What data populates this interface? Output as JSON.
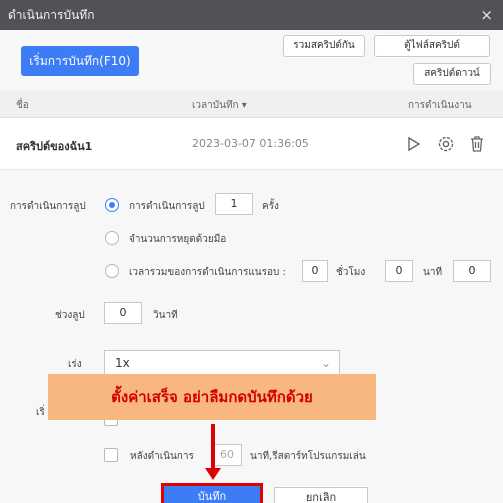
{
  "window": {
    "title": "ดำเนินการบันทึก",
    "close_glyph": "×"
  },
  "toolbar": {
    "record_button": "เริ่มการบันทึก(F10)",
    "merge_script": "รวมสคริปต์กัน",
    "script_folder": "ตู้ไฟล์สคริปต์",
    "download_script": "สคริปต์ดาวน์"
  },
  "table": {
    "headers": {
      "name": "ชื่อ",
      "time": "เวลาบันทึก ▾",
      "actions": "การดำเนินงาน"
    },
    "rows": [
      {
        "name": "สคริปต์ของฉัน1",
        "time": "2023-03-07 01:36:05"
      }
    ]
  },
  "settings": {
    "loop_label": "การดำเนินการลูป",
    "opt_loop": "การดำเนินการลูป",
    "loop_count": "1",
    "loop_unit": "ครั้ง",
    "opt_manual": "จำนวนการหยุดด้วยมือ",
    "opt_time": "เวลารวมของการดำเนินการแนรอบ :",
    "hours": "0",
    "hours_unit": "ชั่วโมง",
    "minutes": "0",
    "minutes_unit": "นาที",
    "seconds": "0",
    "interval_label": "ช่วงลูป",
    "interval_value": "0",
    "interval_unit": "วินาที",
    "speed_label": "เร่ง",
    "speed_value": "1x",
    "after_label": "เริ่",
    "after_run_label": "หลังดำเนินการ",
    "after_run_value": "60",
    "after_run_unit": "นาที,รีสตาร์ทโปรแกรมเล่น"
  },
  "callout": {
    "text": "ตั้งค่าเสร็จ อย่าลืมกดบันทึกด้วย"
  },
  "footer": {
    "save": "บันทึก",
    "cancel": "ยกเลิก"
  }
}
